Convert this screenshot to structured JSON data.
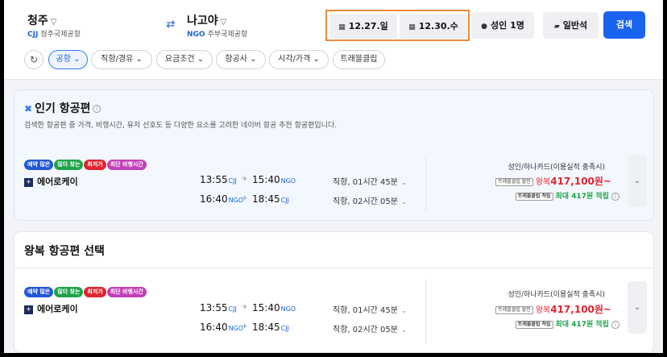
{
  "search": {
    "origin_city": "청주",
    "origin_code": "CJJ",
    "origin_airport": "청주국제공항",
    "dest_city": "나고야",
    "dest_code": "NGO",
    "dest_airport": "주부국제공항",
    "depart_date": "12.27.일",
    "return_date": "12.30.수",
    "passengers": "성인 1명",
    "cabin": "일반석",
    "search_label": "검색",
    "date_box_highlight": "#f08a3a",
    "accent": "#1a63ef"
  },
  "filters": [
    {
      "label": "공항",
      "active": true
    },
    {
      "label": "직항/경유",
      "active": false
    },
    {
      "label": "요금조건",
      "active": false
    },
    {
      "label": "항공사",
      "active": false
    },
    {
      "label": "시각/가격",
      "active": false
    },
    {
      "label": "트래블클립",
      "active": false
    }
  ],
  "popular": {
    "title": "인기 항공편",
    "description": "검색한 항공편 중 가격, 비행시간, 유저 선호도 등 다양한 요소를 고려한 네이버 항공 추천 항공편입니다.",
    "badges": [
      {
        "label": "예약 많은",
        "color": "#2356d6"
      },
      {
        "label": "많이 찾는",
        "color": "#1fa34a"
      },
      {
        "label": "최저가",
        "color": "#e0242f"
      },
      {
        "label": "최단 비행시간",
        "color": "#c23fb8"
      }
    ],
    "airline": "에어로케이",
    "outbound": {
      "dep_time": "13:55",
      "dep_code": "CJJ",
      "arr_time": "15:40",
      "arr_code": "NGO",
      "route": "직항, 01시간 45분"
    },
    "inbound": {
      "dep_time": "16:40",
      "dep_code": "NGO",
      "arr_time": "18:45",
      "arr_code": "CJJ",
      "route": "직항, 02시간 05분"
    },
    "card_label": "성인/하나카드(이용실적 충족시)",
    "discount_tag": "트래블클립 할인",
    "price_prefix": "왕복",
    "price": "417,100원~",
    "reward_tag": "트래블클립 적립",
    "reward": "최대 417원 적립"
  },
  "section": {
    "title": "왕복 항공편 선택",
    "badges": [
      {
        "label": "예약 많은",
        "color": "#2356d6"
      },
      {
        "label": "많이 찾는",
        "color": "#1fa34a"
      },
      {
        "label": "최저가",
        "color": "#e0242f"
      },
      {
        "label": "최단 비행시간",
        "color": "#c23fb8"
      }
    ],
    "airline": "에어로케이",
    "outbound": {
      "dep_time": "13:55",
      "dep_code": "CJJ",
      "arr_time": "15:40",
      "arr_code": "NGO",
      "route": "직항, 01시간 45분"
    },
    "inbound": {
      "dep_time": "16:40",
      "dep_code": "NGO",
      "arr_time": "18:45",
      "arr_code": "CJJ",
      "route": "직항, 02시간 05분"
    },
    "card_label": "성인/하나카드(이용실적 충족시)",
    "discount_tag": "트래블클립 할인",
    "price_prefix": "왕복",
    "price": "417,100원~",
    "reward_tag": "트래블클립 적립",
    "reward": "최대 417원 적립"
  }
}
